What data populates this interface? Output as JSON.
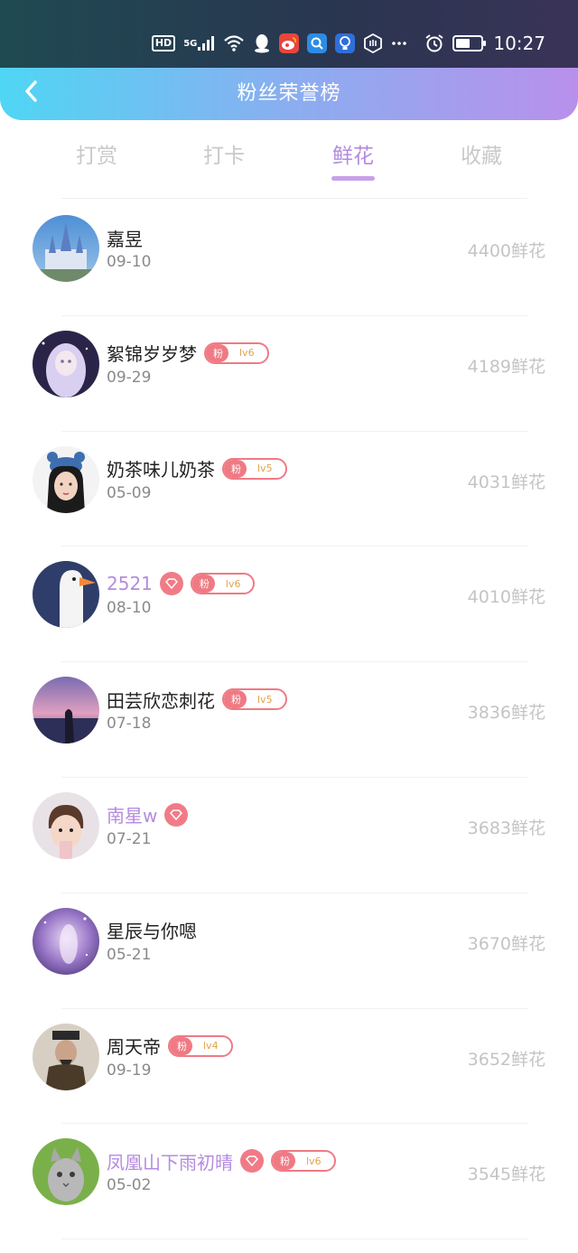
{
  "status_bar": {
    "hd": "HD",
    "network": "5G",
    "time": "10:27",
    "battery_level": 0.55,
    "icons": [
      "signal-icon",
      "wifi-icon",
      "qq-icon",
      "weibo-icon",
      "search-app-icon",
      "bulb-app-icon",
      "hand-app-icon",
      "more-dots-icon",
      "alarm-icon",
      "battery-icon"
    ]
  },
  "header": {
    "title": "粉丝荣誉榜"
  },
  "tabs": [
    {
      "label": "打赏",
      "active": false
    },
    {
      "label": "打卡",
      "active": false
    },
    {
      "label": "鲜花",
      "active": true
    },
    {
      "label": "收藏",
      "active": false
    }
  ],
  "colors": {
    "accent": "#b48be0",
    "badge": "#ef7a84",
    "level_text": "#e3a24a",
    "header_start": "#4fd6f4",
    "header_end": "#b990ec"
  },
  "fans": [
    {
      "name": "嘉昱",
      "date": "09-10",
      "count": "4400鲜花",
      "vip": false,
      "diamond": false,
      "fan_label": "",
      "level": ""
    },
    {
      "name": "絮锦岁岁梦",
      "date": "09-29",
      "count": "4189鲜花",
      "vip": false,
      "diamond": false,
      "fan_label": "粉",
      "level": "lv6"
    },
    {
      "name": "奶茶味儿奶茶",
      "date": "05-09",
      "count": "4031鲜花",
      "vip": false,
      "diamond": false,
      "fan_label": "粉",
      "level": "lv5"
    },
    {
      "name": "2521",
      "date": "08-10",
      "count": "4010鲜花",
      "vip": true,
      "diamond": true,
      "fan_label": "粉",
      "level": "lv6"
    },
    {
      "name": "田芸欣恋刺花",
      "date": "07-18",
      "count": "3836鲜花",
      "vip": false,
      "diamond": false,
      "fan_label": "粉",
      "level": "lv5"
    },
    {
      "name": "南星w",
      "date": "07-21",
      "count": "3683鲜花",
      "vip": true,
      "diamond": true,
      "fan_label": "",
      "level": ""
    },
    {
      "name": "星辰与你嗯",
      "date": "05-21",
      "count": "3670鲜花",
      "vip": false,
      "diamond": false,
      "fan_label": "",
      "level": ""
    },
    {
      "name": "周天帝",
      "date": "09-19",
      "count": "3652鲜花",
      "vip": false,
      "diamond": false,
      "fan_label": "粉",
      "level": "lv4"
    },
    {
      "name": "凤凰山下雨初晴",
      "date": "05-02",
      "count": "3545鲜花",
      "vip": true,
      "diamond": true,
      "fan_label": "粉",
      "level": "lv6"
    }
  ]
}
